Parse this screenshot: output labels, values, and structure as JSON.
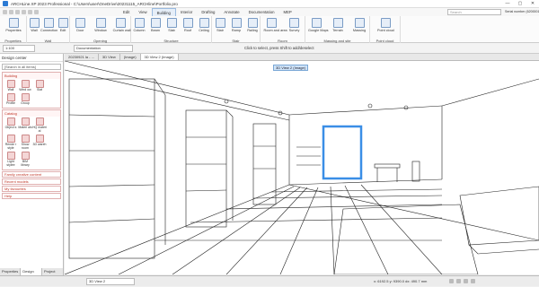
{
  "window": {
    "title": "ARCHLine.XP 2023 Professional - C:\\Users\\user\\OneDrive\\20231115_ARCHline\\Portfolio.pro",
    "min": "—",
    "max": "▢",
    "close": "✕"
  },
  "menu": {
    "items": [
      "Edit",
      "View",
      "Building",
      "Interior",
      "Drafting",
      "Annotate",
      "Documentation",
      "MEP"
    ],
    "active": "Building",
    "search_placeholder": "Search",
    "serial": "Serial number (6200001)"
  },
  "ribbon": {
    "groups": [
      {
        "label": "Properties",
        "buttons": [
          "Properties"
        ]
      },
      {
        "label": "Wall",
        "buttons": [
          "Wall",
          "Connection",
          "Edit"
        ]
      },
      {
        "label": "Opening",
        "buttons": [
          "Door",
          "Window",
          "Curtain wall"
        ]
      },
      {
        "label": "Structure",
        "buttons": [
          "Column",
          "Beam",
          "Slab",
          "Roof",
          "Ceiling"
        ]
      },
      {
        "label": "Stair",
        "buttons": [
          "Stair",
          "Ramp",
          "Railing"
        ]
      },
      {
        "label": "Room",
        "buttons": [
          "Room and area",
          "Survey"
        ]
      },
      {
        "label": "Massing and site",
        "buttons": [
          "Google Maps",
          "Terrain",
          "Massing"
        ]
      },
      {
        "label": "Point cloud",
        "buttons": [
          "Point cloud"
        ]
      }
    ]
  },
  "toolbar": {
    "scale": "1:100",
    "layer": "Documentation",
    "hint": "Click to select, press Shift to add/deselect"
  },
  "leftpanel": {
    "title": "Design center",
    "search": "[Search in all items]",
    "building": {
      "header": "Building",
      "items": [
        "Wall",
        "Wind ow",
        "Slat",
        "Profile",
        "Group"
      ]
    },
    "catalog": {
      "header": "Catalog",
      "items": [
        "Object s",
        "Materi als",
        "HQ materi al",
        "Rende r style",
        "Show room",
        "3D wareh",
        "Light stylee",
        "BIM library"
      ]
    },
    "links": [
      "Family creative content",
      "Recent models",
      "My favourites",
      "Help"
    ]
  },
  "left_tabs": [
    "Properties",
    "Design ce..",
    "Project na.."
  ],
  "doc_tabs": [
    "20230921 la - ...",
    "3D View",
    "(Image)",
    "3D View 2 (Image)"
  ],
  "viewport": {
    "label": "3D View 2 (Image)"
  },
  "statusbar": {
    "view_field": "3D View 2",
    "coords": "x: 6192.5   y: 9390.0   dx: 490.7 mm",
    "unit": "mm"
  },
  "colors": {
    "accent": "#2c7bd4",
    "highlight": "#3a8ee6",
    "catalog_red": "#c0392b"
  }
}
